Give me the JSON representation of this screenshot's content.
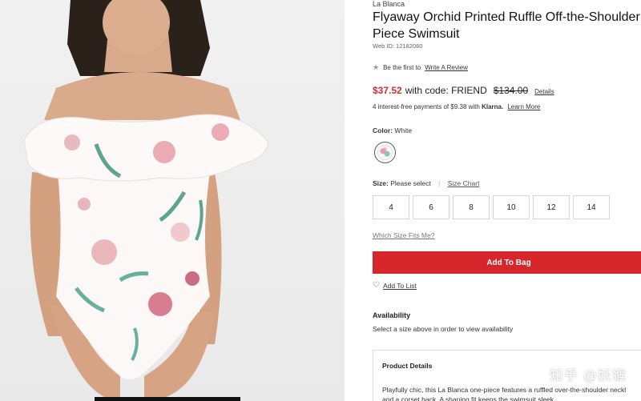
{
  "product": {
    "brand": "La Blanca",
    "title_line1": "Flyaway Orchid Printed Ruffle Off-the-Shoulder O",
    "title_line2": "Piece Swimsuit",
    "web_id": "Web ID: 12182060"
  },
  "reviews": {
    "prompt": "Be the first to",
    "link": "Write A Review"
  },
  "pricing": {
    "sale_price": "$37.52",
    "promo_text": "with code: FRIEND",
    "original_price": "$134.00",
    "details_link": "Details",
    "installments": "4 interest-free payments of $9.38 with",
    "klarna": "Klarna.",
    "learn_more": "Learn More",
    "sale_color": "#d32e30"
  },
  "color": {
    "label": "Color:",
    "value": "White"
  },
  "size": {
    "label": "Size:",
    "value": "Please select",
    "chart_link": "Size Chart",
    "options": [
      "4",
      "6",
      "8",
      "10",
      "12",
      "14"
    ],
    "fit_link": "Which Size Fits Me?"
  },
  "actions": {
    "add_to_bag": "Add To Bag",
    "add_to_list": "Add To List",
    "button_color": "#d7262b"
  },
  "availability": {
    "title": "Availability",
    "text": "Select a size above in order to view availability"
  },
  "product_details": {
    "title": "Product Details",
    "line1": "Playfully chic, this La Blanca one-piece features a ruffled over-the-shoulder neckl",
    "line2": "and a corset back. A shaping fit keeps the swimsuit sleek"
  },
  "watermark": "知乎 @妖猴"
}
